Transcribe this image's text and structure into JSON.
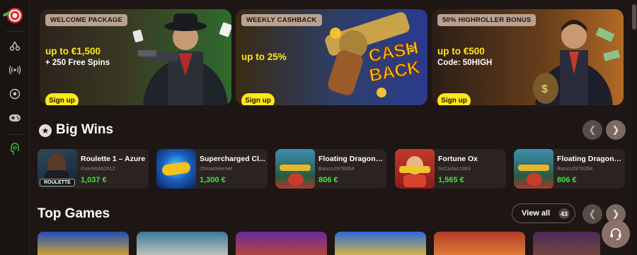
{
  "sidebar": {
    "items": [
      {
        "icon": "logo-icon"
      },
      {
        "icon": "cherry-icon"
      },
      {
        "icon": "live-broadcast-icon"
      },
      {
        "icon": "soccer-ball-icon"
      },
      {
        "icon": "gamepad-icon"
      },
      {
        "icon": "responsible-gaming-icon"
      }
    ]
  },
  "promos": [
    {
      "tag": "WELCOME PACKAGE",
      "amount": "up to €1,500",
      "sub": "+ 250 Free Spins",
      "button": "Sign up"
    },
    {
      "tag": "WEEKLY CASHBACK",
      "amount": "up to 25%",
      "sub": "",
      "button": "Sign up",
      "art_text_1": "CASH",
      "art_text_2": "BACK"
    },
    {
      "tag": "50% HIGHROLLER BONUS",
      "amount": "up to €500",
      "sub": "Code: 50HIGH",
      "button": "Sign up"
    }
  ],
  "big_wins": {
    "title": "Big Wins",
    "items": [
      {
        "game": "Roulette 1 – Azure",
        "user": "Ruin96462812",
        "amount": "1,037 €",
        "thumb_label": "ROULETTE"
      },
      {
        "game": "Supercharged Cl...",
        "user": "25martHornet",
        "amount": "1,300 €"
      },
      {
        "game": "Floating Dragon -...",
        "user": "Banco2978354",
        "amount": "806 €"
      },
      {
        "game": "Fortune Ox",
        "user": "SrCarlos1983",
        "amount": "1,565 €"
      },
      {
        "game": "Floating Dragon -...",
        "user": "Banco2978354",
        "amount": "806 €"
      }
    ]
  },
  "top_games": {
    "title": "Top Games",
    "view_all": "View all",
    "count": "43"
  },
  "colors": {
    "background": "#1d1614",
    "accent_yellow": "#ffe81a",
    "win_green": "#3ce63c"
  }
}
